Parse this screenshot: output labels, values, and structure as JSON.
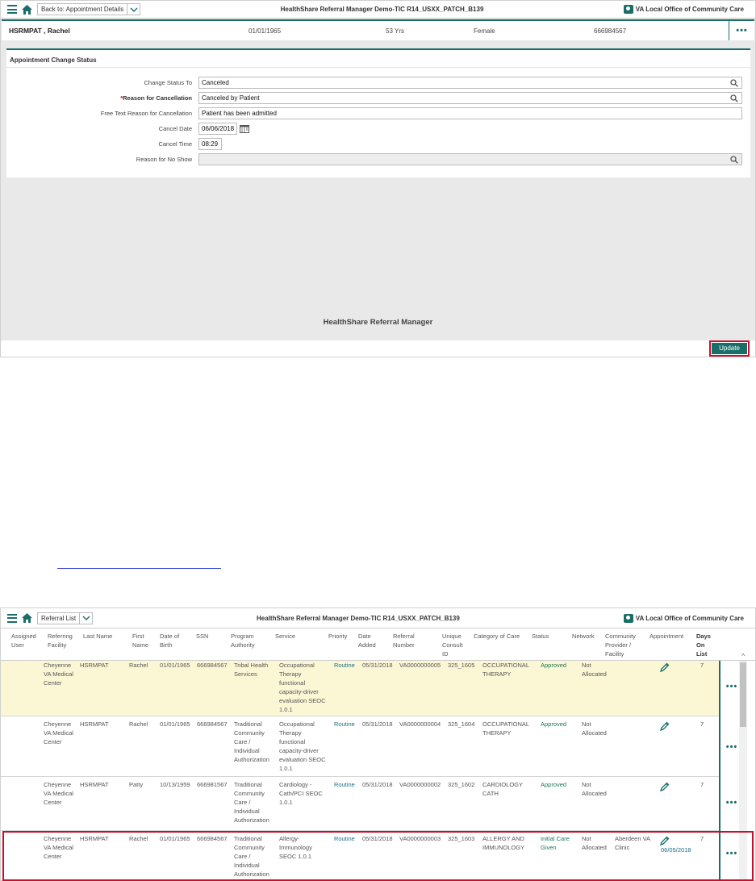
{
  "shot1": {
    "back_label": "Back to: Appointment Details",
    "app_title": "HealthShare Referral Manager Demo-TIC R14_USXX_PATCH_B139",
    "office": "VA Local Office of Community Care",
    "patient": {
      "name": "HSRMPAT , Rachel",
      "dob": "01/01/1965",
      "age": "53 Yrs",
      "sex": "Female",
      "ssn": "666984567",
      "more": "•••"
    },
    "form": {
      "title": "Appointment Change Status",
      "change_status_label": "Change Status To",
      "change_status_value": "Canceled",
      "reason_label": "Reason for Cancellation",
      "reason_star": "*",
      "reason_value": "Canceled by Patient",
      "free_text_label": "Free Text Reason for Cancellation",
      "free_text_value": "Patient has been admitted",
      "cancel_date_label": "Cancel Date",
      "cancel_date_value": "06/06/2018",
      "cancel_time_label": "Cancel Time",
      "cancel_time_value": "08:29",
      "no_show_label": "Reason for No Show",
      "no_show_value": ""
    },
    "footer_brand": "HealthShare Referral Manager",
    "update_label": "Update"
  },
  "shot2": {
    "nav_label": "Referral List",
    "app_title": "HealthShare Referral Manager Demo-TIC R14_USXX_PATCH_B139",
    "office": "VA Local Office of Community Care",
    "columns": [
      "Assigned User",
      "Referring Facility",
      "Last Name",
      "First Name",
      "Date of Birth",
      "SSN",
      "Program Authority",
      "Service",
      "Priority",
      "Date Added",
      "Referral Number",
      "Unique Consult ID",
      "Category of Care",
      "Status",
      "Network",
      "Community Provider / Facility",
      "Appointment",
      "Days On List"
    ],
    "rows": [
      {
        "facility": "Cheyenne VA Medical Center",
        "last": "HSRMPAT",
        "first": "Rachel",
        "dob": "01/01/1965",
        "ssn": "666984567",
        "program": "Tribal Health Services",
        "service": "Occupational Therapy functional capacity-driver evaluation SEOC 1.0.1",
        "priority": "Routine",
        "added": "05/31/2018",
        "referral": "VA0000000005",
        "consult": "325_1605",
        "category": "OCCUPATIONAL THERAPY",
        "status": "Approved",
        "network": "Not Allocated",
        "provider": "",
        "appointment": "",
        "days": "7"
      },
      {
        "facility": "Cheyenne VA Medical Center",
        "last": "HSRMPAT",
        "first": "Rachel",
        "dob": "01/01/1965",
        "ssn": "666984567",
        "program": "Traditional Community Care / Individual Authorization",
        "service": "Occupational Therapy functional capacity-driver evaluation SEOC 1.0.1",
        "priority": "Routine",
        "added": "05/31/2018",
        "referral": "VA0000000004",
        "consult": "325_1604",
        "category": "OCCUPATIONAL THERAPY",
        "status": "Approved",
        "network": "Not Allocated",
        "provider": "",
        "appointment": "",
        "days": "7"
      },
      {
        "facility": "Cheyenne VA Medical Center",
        "last": "HSRMPAT",
        "first": "Patty",
        "dob": "10/13/1959",
        "ssn": "666981567",
        "program": "Traditional Community Care / Individual Authorization",
        "service": "Cardiology - Cath/PCI SEOC 1.0.1",
        "priority": "Routine",
        "added": "05/31/2018",
        "referral": "VA0000000002",
        "consult": "325_1602",
        "category": "CARDIOLOGY CATH",
        "status": "Approved",
        "network": "Not Allocated",
        "provider": "",
        "appointment": "",
        "days": "7"
      },
      {
        "facility": "Cheyenne VA Medical Center",
        "last": "HSRMPAT",
        "first": "Rachel",
        "dob": "01/01/1965",
        "ssn": "666984567",
        "program": "Traditional Community Care / Individual Authorization",
        "service": "Allergy-Immunology SEOC 1.0.1",
        "priority": "Routine",
        "added": "05/31/2018",
        "referral": "VA0000000003",
        "consult": "325_1603",
        "category": "ALLERGY AND IMMUNOLOGY",
        "status": "Initial Care Given",
        "network": "Not Allocated",
        "provider": "Aberdeen VA Clinic",
        "appointment": "06/05/2018",
        "days": "7"
      }
    ],
    "more": "•••",
    "scroll_up": "^"
  },
  "colors": {
    "accent": "#1a6e6a",
    "highlight_row": "#fbf7d5",
    "callout": "#c8102e"
  }
}
